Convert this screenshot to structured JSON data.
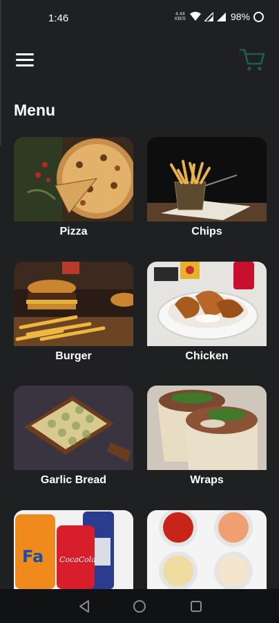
{
  "status_bar": {
    "time": "1:46",
    "network_top": "4.44",
    "network_bottom": "KB/S",
    "battery": "98%",
    "icons": [
      "wifi-icon",
      "signal-icon",
      "signal-icon",
      "battery-ring-icon"
    ]
  },
  "header": {
    "menu_icon": "hamburger-icon",
    "cart_icon": "cart-icon",
    "cart_color": "#1f5f47"
  },
  "page": {
    "title": "Menu"
  },
  "menu_items": [
    {
      "label": "Pizza",
      "image": "pizza-photo"
    },
    {
      "label": "Chips",
      "image": "chips-photo"
    },
    {
      "label": "Burger",
      "image": "burger-photo"
    },
    {
      "label": "Chicken",
      "image": "chicken-photo"
    },
    {
      "label": "Garlic Bread",
      "image": "garlic-bread-photo"
    },
    {
      "label": "Wraps",
      "image": "wraps-photo"
    },
    {
      "label": "",
      "image": "drinks-photo"
    },
    {
      "label": "",
      "image": "sauces-photo"
    }
  ],
  "nav_bar": {
    "icons": [
      "back-icon",
      "home-icon",
      "recents-icon"
    ]
  }
}
